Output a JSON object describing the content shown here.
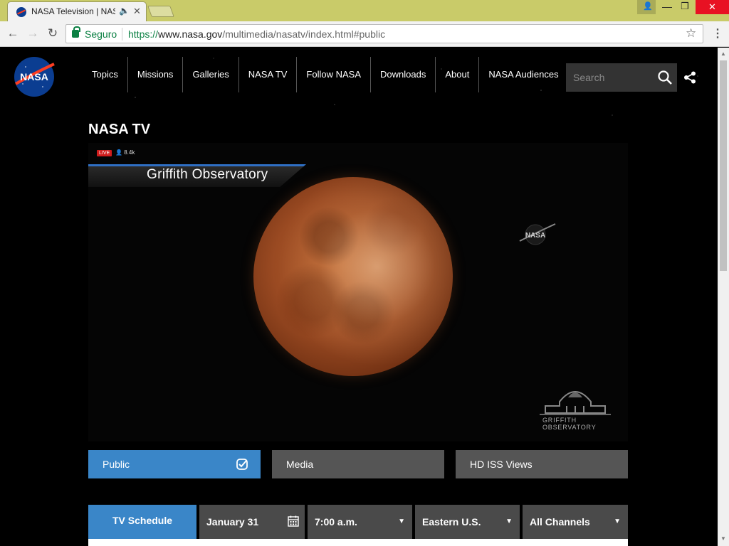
{
  "browser": {
    "tab_title": "NASA Television | NASA",
    "tab_audio_icon": "speaker-icon",
    "tab_close": "✕",
    "secure_label": "Seguro",
    "url_proto": "https://",
    "url_host": "www.nasa.gov",
    "url_path": "/multimedia/nasatv/index.html#public",
    "window_controls": {
      "minimize": "—",
      "maximize": "❐",
      "close": "✕"
    }
  },
  "nav": {
    "items": [
      "Topics",
      "Missions",
      "Galleries",
      "NASA TV",
      "Follow NASA",
      "Downloads",
      "About",
      "NASA Audiences"
    ],
    "search_placeholder": "Search"
  },
  "page": {
    "title": "NASA TV"
  },
  "video": {
    "live_label": "LIVE",
    "viewer_count": "8.4k",
    "banner_text": "Griffith Observatory",
    "corner_logo_text": "NASA",
    "watermark_text": "GRIFFITH OBSERVATORY"
  },
  "channels": {
    "items": [
      {
        "label": "Public",
        "selected": true
      },
      {
        "label": "Media",
        "selected": false
      },
      {
        "label": "HD ISS Views",
        "selected": false
      }
    ]
  },
  "schedule": {
    "title": "TV Schedule",
    "date": "January 31",
    "time": "7:00 a.m.",
    "timezone": "Eastern U.S.",
    "channel": "All Channels"
  },
  "colors": {
    "accent_blue": "#3a86c8",
    "inactive_tab": "#555555",
    "chrome_titlebar": "#c9cb69",
    "secure_green": "#0b8043",
    "close_red": "#e81123"
  }
}
